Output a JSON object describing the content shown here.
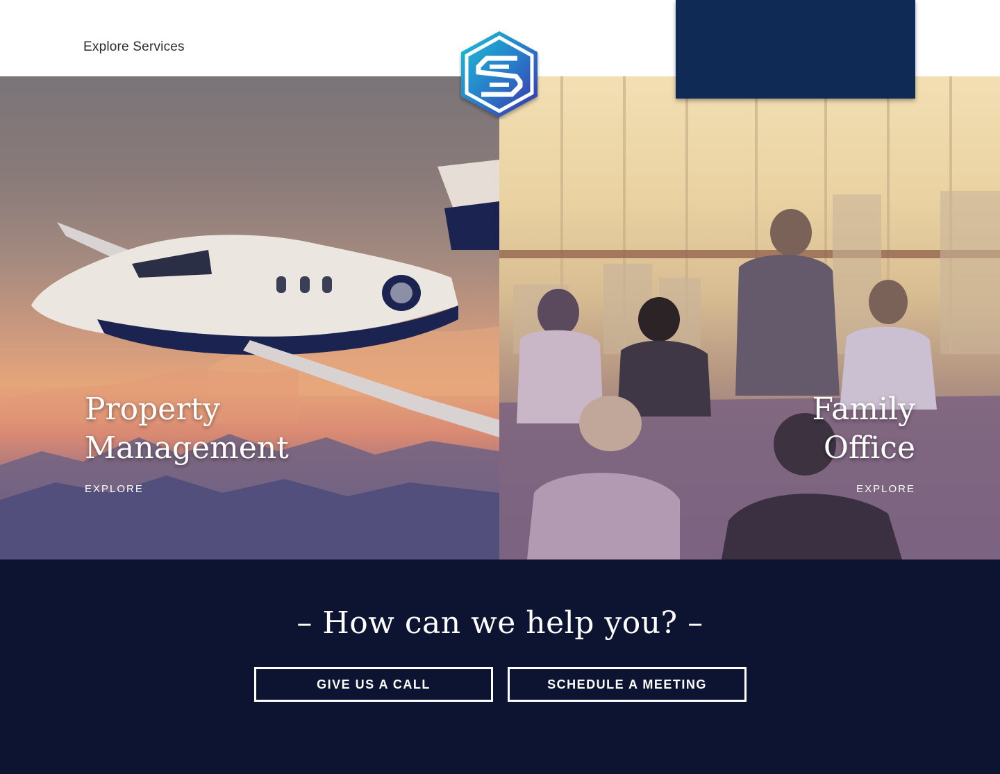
{
  "header": {
    "explore_label": "Explore Services"
  },
  "logo": {
    "icon": "hexagon-s-logo-icon"
  },
  "panels": [
    {
      "title_line1": "Property",
      "title_line2": "Management",
      "cta": "EXPLORE"
    },
    {
      "title_line1": "Family",
      "title_line2": "Office",
      "cta": "EXPLORE"
    }
  ],
  "contact": {
    "heading": "– How can we help you? –",
    "call_label": "GIVE US A CALL",
    "meeting_label": "SCHEDULE A MEETING"
  },
  "colors": {
    "navy_block": "#0e2a55",
    "footer_bg": "#0c1431",
    "logo_gradient_start": "#19c3d6",
    "logo_gradient_end": "#3a2fa8"
  }
}
